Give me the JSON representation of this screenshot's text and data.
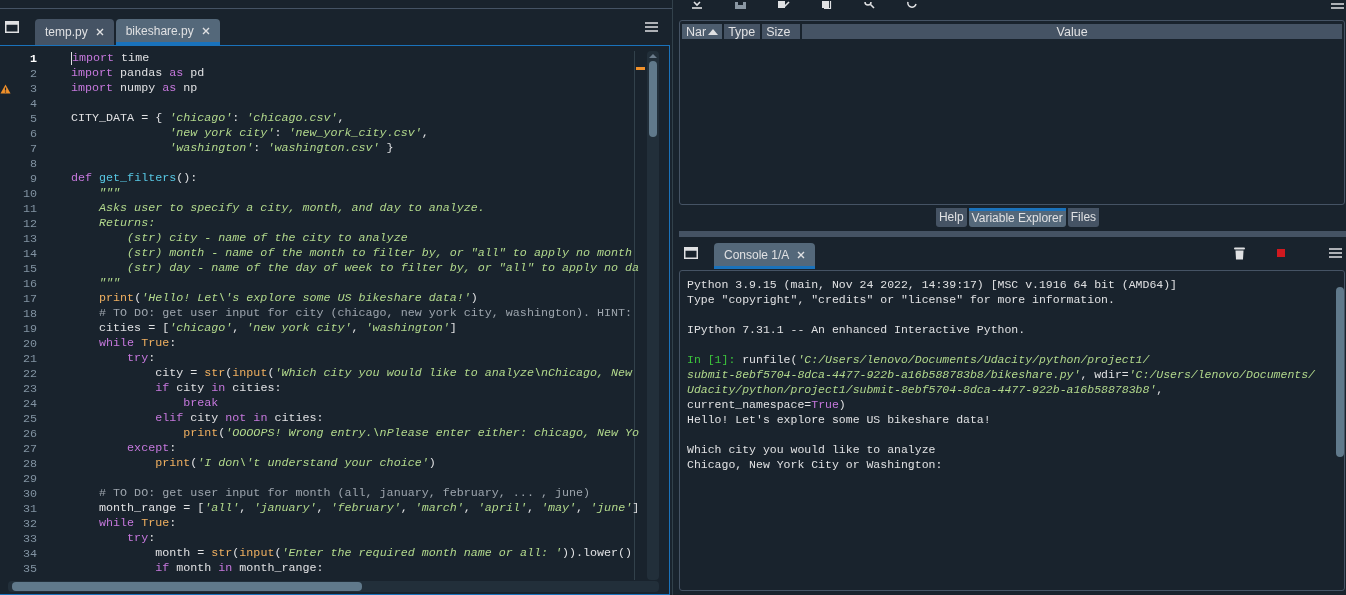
{
  "editor": {
    "tabs": [
      {
        "label": "temp.py",
        "selected": false
      },
      {
        "label": "bikeshare.py",
        "selected": true
      }
    ],
    "lines": [
      {
        "number": "1",
        "current": true,
        "warning": false,
        "tokens": [
          {
            "kind": "keyword",
            "text": "import"
          },
          {
            "kind": "plain",
            "text": " time"
          }
        ]
      },
      {
        "number": "2",
        "current": false,
        "warning": false,
        "tokens": [
          {
            "kind": "keyword",
            "text": "import"
          },
          {
            "kind": "plain",
            "text": " pandas "
          },
          {
            "kind": "keyword",
            "text": "as"
          },
          {
            "kind": "plain",
            "text": " pd"
          }
        ]
      },
      {
        "number": "3",
        "current": false,
        "warning": true,
        "tokens": [
          {
            "kind": "keyword",
            "text": "import"
          },
          {
            "kind": "plain",
            "text": " numpy "
          },
          {
            "kind": "keyword",
            "text": "as"
          },
          {
            "kind": "plain",
            "text": " np"
          }
        ]
      },
      {
        "number": "4",
        "current": false,
        "warning": false
      },
      {
        "number": "5",
        "current": false,
        "warning": false,
        "tokens": [
          {
            "kind": "plain",
            "text": "CITY_DATA = { "
          },
          {
            "kind": "string",
            "text": "'chicago'"
          },
          {
            "kind": "plain",
            "text": ": "
          },
          {
            "kind": "string",
            "text": "'chicago.csv'"
          },
          {
            "kind": "plain",
            "text": ","
          }
        ]
      },
      {
        "number": "6",
        "current": false,
        "warning": false,
        "tokens": [
          {
            "kind": "string",
            "text": "              'new york city'"
          },
          {
            "kind": "plain",
            "text": ": "
          },
          {
            "kind": "string",
            "text": "'new_york_city.csv'"
          },
          {
            "kind": "plain",
            "text": ","
          }
        ]
      },
      {
        "number": "7",
        "current": false,
        "warning": false,
        "tokens": [
          {
            "kind": "string",
            "text": "              'washington'"
          },
          {
            "kind": "plain",
            "text": ": "
          },
          {
            "kind": "string",
            "text": "'washington.csv'"
          },
          {
            "kind": "plain",
            "text": " }"
          }
        ]
      },
      {
        "number": "8",
        "current": false,
        "warning": false
      },
      {
        "number": "9",
        "current": false,
        "warning": false,
        "tokens": [
          {
            "kind": "keyword",
            "text": "def"
          },
          {
            "kind": "function",
            "text": " get_filters"
          },
          {
            "kind": "plain",
            "text": "():"
          }
        ]
      },
      {
        "number": "10",
        "current": false,
        "warning": false,
        "tokens": [
          {
            "kind": "string",
            "text": "    \"\"\""
          }
        ]
      },
      {
        "number": "11",
        "current": false,
        "warning": false,
        "tokens": [
          {
            "kind": "string",
            "text": "    Asks user to specify a city, month, and day to analyze."
          }
        ]
      },
      {
        "number": "12",
        "current": false,
        "warning": false,
        "tokens": [
          {
            "kind": "string",
            "text": "    Returns:"
          }
        ]
      },
      {
        "number": "13",
        "current": false,
        "warning": false,
        "tokens": [
          {
            "kind": "string",
            "text": "        (str) city - name of the city to analyze"
          }
        ]
      },
      {
        "number": "14",
        "current": false,
        "warning": false,
        "tokens": [
          {
            "kind": "string",
            "text": "        (str) month - name of the month to filter by, or \"all\" to apply no month"
          }
        ]
      },
      {
        "number": "15",
        "current": false,
        "warning": false,
        "tokens": [
          {
            "kind": "string",
            "text": "        (str) day - name of the day of week to filter by, or \"all\" to apply no da"
          }
        ]
      },
      {
        "number": "16",
        "current": false,
        "warning": false,
        "tokens": [
          {
            "kind": "string",
            "text": "    \"\"\""
          }
        ]
      },
      {
        "number": "17",
        "current": false,
        "warning": false,
        "tokens": [
          {
            "kind": "builtin",
            "text": "    print"
          },
          {
            "kind": "plain",
            "text": "("
          },
          {
            "kind": "string",
            "text": "'Hello! Let\\'s explore some US bikeshare data!'"
          },
          {
            "kind": "plain",
            "text": ")"
          }
        ]
      },
      {
        "number": "18",
        "current": false,
        "warning": false,
        "tokens": [
          {
            "kind": "comment",
            "text": "    # TO DO: get user input for city (chicago, new york city, washington). HINT:"
          }
        ]
      },
      {
        "number": "19",
        "current": false,
        "warning": false,
        "tokens": [
          {
            "kind": "plain",
            "text": "    cities = ["
          },
          {
            "kind": "string",
            "text": "'chicago'"
          },
          {
            "kind": "plain",
            "text": ", "
          },
          {
            "kind": "string",
            "text": "'new york city'"
          },
          {
            "kind": "plain",
            "text": ", "
          },
          {
            "kind": "string",
            "text": "'washington'"
          },
          {
            "kind": "plain",
            "text": "]"
          }
        ]
      },
      {
        "number": "20",
        "current": false,
        "warning": false,
        "tokens": [
          {
            "kind": "keyword",
            "text": "    while "
          },
          {
            "kind": "builtin",
            "text": "True"
          },
          {
            "kind": "plain",
            "text": ":"
          }
        ]
      },
      {
        "number": "21",
        "current": false,
        "warning": false,
        "tokens": [
          {
            "kind": "keyword",
            "text": "        try"
          },
          {
            "kind": "plain",
            "text": ":"
          }
        ]
      },
      {
        "number": "22",
        "current": false,
        "warning": false,
        "tokens": [
          {
            "kind": "plain",
            "text": "            city = "
          },
          {
            "kind": "builtin",
            "text": "str"
          },
          {
            "kind": "plain",
            "text": "("
          },
          {
            "kind": "builtin",
            "text": "input"
          },
          {
            "kind": "plain",
            "text": "("
          },
          {
            "kind": "string",
            "text": "'Which city you would like to analyze\\nChicago, New"
          }
        ]
      },
      {
        "number": "23",
        "current": false,
        "warning": false,
        "tokens": [
          {
            "kind": "keyword",
            "text": "            if"
          },
          {
            "kind": "plain",
            "text": " city "
          },
          {
            "kind": "keyword",
            "text": "in"
          },
          {
            "kind": "plain",
            "text": " cities:"
          }
        ]
      },
      {
        "number": "24",
        "current": false,
        "warning": false,
        "tokens": [
          {
            "kind": "keyword",
            "text": "                break"
          }
        ]
      },
      {
        "number": "25",
        "current": false,
        "warning": false,
        "tokens": [
          {
            "kind": "keyword",
            "text": "            elif"
          },
          {
            "kind": "plain",
            "text": " city "
          },
          {
            "kind": "keyword",
            "text": "not in"
          },
          {
            "kind": "plain",
            "text": " cities:"
          }
        ]
      },
      {
        "number": "26",
        "current": false,
        "warning": false,
        "tokens": [
          {
            "kind": "builtin",
            "text": "                print"
          },
          {
            "kind": "plain",
            "text": "("
          },
          {
            "kind": "string",
            "text": "'OOOOPS! Wrong entry.\\nPlease enter either: chicago, New Yo"
          }
        ]
      },
      {
        "number": "27",
        "current": false,
        "warning": false,
        "tokens": [
          {
            "kind": "keyword",
            "text": "        except"
          },
          {
            "kind": "plain",
            "text": ":"
          }
        ]
      },
      {
        "number": "28",
        "current": false,
        "warning": false,
        "tokens": [
          {
            "kind": "builtin",
            "text": "            print"
          },
          {
            "kind": "plain",
            "text": "("
          },
          {
            "kind": "string",
            "text": "'I don\\'t understand your choice'"
          },
          {
            "kind": "plain",
            "text": ")"
          }
        ]
      },
      {
        "number": "29",
        "current": false,
        "warning": false
      },
      {
        "number": "30",
        "current": false,
        "warning": false,
        "tokens": [
          {
            "kind": "comment",
            "text": "    # TO DO: get user input for month (all, january, february, ... , june)"
          }
        ]
      },
      {
        "number": "31",
        "current": false,
        "warning": false,
        "tokens": [
          {
            "kind": "plain",
            "text": "    month_range = ["
          },
          {
            "kind": "string",
            "text": "'all'"
          },
          {
            "kind": "plain",
            "text": ", "
          },
          {
            "kind": "string",
            "text": "'january'"
          },
          {
            "kind": "plain",
            "text": ", "
          },
          {
            "kind": "string",
            "text": "'february'"
          },
          {
            "kind": "plain",
            "text": ", "
          },
          {
            "kind": "string",
            "text": "'march'"
          },
          {
            "kind": "plain",
            "text": ", "
          },
          {
            "kind": "string",
            "text": "'april'"
          },
          {
            "kind": "plain",
            "text": ", "
          },
          {
            "kind": "string",
            "text": "'may'"
          },
          {
            "kind": "plain",
            "text": ", "
          },
          {
            "kind": "string",
            "text": "'june'"
          },
          {
            "kind": "plain",
            "text": "]"
          }
        ]
      },
      {
        "number": "32",
        "current": false,
        "warning": false,
        "tokens": [
          {
            "kind": "keyword",
            "text": "    while "
          },
          {
            "kind": "builtin",
            "text": "True"
          },
          {
            "kind": "plain",
            "text": ":"
          }
        ]
      },
      {
        "number": "33",
        "current": false,
        "warning": false,
        "tokens": [
          {
            "kind": "keyword",
            "text": "        try"
          },
          {
            "kind": "plain",
            "text": ":"
          }
        ]
      },
      {
        "number": "34",
        "current": false,
        "warning": false,
        "tokens": [
          {
            "kind": "plain",
            "text": "            month = "
          },
          {
            "kind": "builtin",
            "text": "str"
          },
          {
            "kind": "plain",
            "text": "("
          },
          {
            "kind": "builtin",
            "text": "input"
          },
          {
            "kind": "plain",
            "text": "("
          },
          {
            "kind": "string",
            "text": "'Enter the required month name or all: '"
          },
          {
            "kind": "plain",
            "text": ")).lower()"
          }
        ]
      },
      {
        "number": "35",
        "current": false,
        "warning": false,
        "tokens": [
          {
            "kind": "keyword",
            "text": "            if"
          },
          {
            "kind": "plain",
            "text": " month "
          },
          {
            "kind": "keyword",
            "text": "in"
          },
          {
            "kind": "plain",
            "text": " month_range:"
          }
        ]
      }
    ]
  },
  "variable_explorer": {
    "columns": [
      {
        "label": "Nar",
        "sorted": true
      },
      {
        "label": "Type",
        "sorted": false
      },
      {
        "label": "Size",
        "sorted": false
      },
      {
        "label": "Value",
        "sorted": false
      }
    ]
  },
  "pane_tabs": [
    {
      "label": "Help",
      "selected": false
    },
    {
      "label": "Variable Explorer",
      "selected": true
    },
    {
      "label": "Files",
      "selected": false
    }
  ],
  "console": {
    "tabs": [
      {
        "label": "Console 1/A",
        "selected": true
      }
    ],
    "blocks": [
      {
        "lines": [
          [
            {
              "kind": "plain",
              "text": "Python 3.9.15 (main, Nov 24 2022, 14:39:17) [MSC v.1916 64 bit (AMD64)]"
            }
          ],
          [
            {
              "kind": "plain",
              "text": "Type \"copyright\", \"credits\" or \"license\" for more information."
            }
          ]
        ]
      },
      {
        "lines": [
          [
            {
              "kind": "plain",
              "text": "IPython 7.31.1 -- An enhanced Interactive Python."
            }
          ]
        ]
      },
      {
        "lines": [
          [
            {
              "kind": "prompt",
              "text": "In [1]:"
            },
            {
              "kind": "plain",
              "text": " runfile("
            },
            {
              "kind": "string",
              "text": "'C:/Users/lenovo/Documents/Udacity/python/project1/"
            }
          ],
          [
            {
              "kind": "string",
              "text": "submit-8ebf5704-8dca-4477-922b-a16b588783b8/bikeshare.py'"
            },
            {
              "kind": "plain",
              "text": ", wdir="
            },
            {
              "kind": "string",
              "text": "'C:/Users/lenovo/Documents/"
            }
          ],
          [
            {
              "kind": "string",
              "text": "Udacity/python/project1/submit-8ebf5704-8dca-4477-922b-a16b588783b8'"
            },
            {
              "kind": "plain",
              "text": ","
            }
          ],
          [
            {
              "kind": "plain",
              "text": "current_namespace="
            },
            {
              "kind": "keyword",
              "text": "True"
            },
            {
              "kind": "plain",
              "text": ")"
            }
          ],
          [
            {
              "kind": "plain",
              "text": "Hello! Let's explore some US bikeshare data!"
            }
          ]
        ]
      },
      {
        "lines": [
          [
            {
              "kind": "plain",
              "text": "Which city you would like to analyze"
            }
          ],
          [
            {
              "kind": "plain",
              "text": "Chicago, New York City or Washington:"
            }
          ]
        ]
      }
    ]
  }
}
